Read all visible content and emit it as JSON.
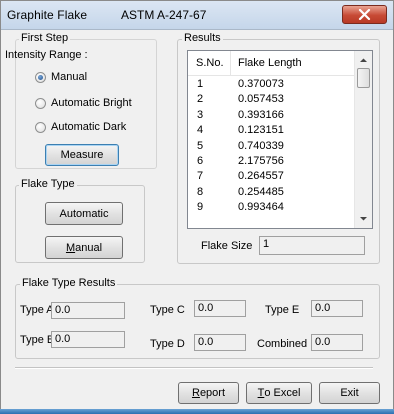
{
  "window": {
    "title": "Graphite Flake",
    "standard": "ASTM A-247-67",
    "close_icon": "close-icon"
  },
  "first_step": {
    "group_label": "First Step",
    "intensity_label": "Intensity Range :",
    "radios": [
      {
        "label": "Manual",
        "selected": true
      },
      {
        "label": "Automatic Bright",
        "selected": false
      },
      {
        "label": "Automatic Dark",
        "selected": false
      }
    ],
    "measure_button": "Measure"
  },
  "flake_type": {
    "group_label": "Flake Type",
    "automatic_button": "Automatic",
    "manual_button": "Manual"
  },
  "results": {
    "group_label": "Results",
    "columns": [
      "S.No.",
      "Flake Length"
    ],
    "rows": [
      [
        "1",
        "0.370073"
      ],
      [
        "2",
        "0.057453"
      ],
      [
        "3",
        "0.393166"
      ],
      [
        "4",
        "0.123151"
      ],
      [
        "5",
        "0.740339"
      ],
      [
        "6",
        "2.175756"
      ],
      [
        "7",
        "0.264557"
      ],
      [
        "8",
        "0.254485"
      ],
      [
        "9",
        "0.993464"
      ]
    ],
    "flake_size_label": "Flake Size",
    "flake_size_value": "1"
  },
  "flake_type_results": {
    "group_label": "Flake Type Results",
    "type_a_label": "Type A",
    "type_a_value": "0.0",
    "type_b_label": "Type B",
    "type_b_value": "0.0",
    "type_c_label": "Type C",
    "type_c_value": "0.0",
    "type_d_label": "Type D",
    "type_d_value": "0.0",
    "type_e_label": "Type E",
    "type_e_value": "0.0",
    "combined_label": "Combined",
    "combined_value": "0.0"
  },
  "footer": {
    "report_button": "Report",
    "excel_button": "To Excel",
    "exit_button": "Exit"
  }
}
